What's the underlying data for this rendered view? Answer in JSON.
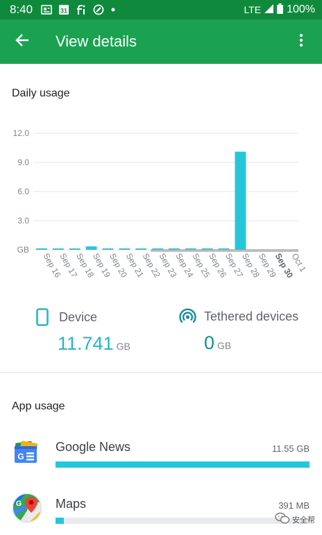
{
  "status_bar": {
    "time": "8:40",
    "network": "LTE",
    "battery": "100%",
    "icons": [
      "news-notification-icon",
      "calendar-icon",
      "fi-icon",
      "speedometer-icon",
      "dot-icon"
    ],
    "calendar_day": "31"
  },
  "app_bar": {
    "title": "View details",
    "back_icon": "arrow-back-icon",
    "more_icon": "more-vert-icon"
  },
  "daily_usage": {
    "title": "Daily usage",
    "chart_data": {
      "type": "bar",
      "categories": [
        "Sep 16",
        "Sep 17",
        "Sep 18",
        "Sep 19",
        "Sep 20",
        "Sep 21",
        "Sep 22",
        "Sep 23",
        "Sep 24",
        "Sep 25",
        "Sep 26",
        "Sep 27",
        "Sep 28",
        "Sep 29",
        "Sep 30",
        "Oct 1"
      ],
      "values": [
        0.15,
        0.02,
        0.05,
        0.35,
        0.03,
        0.05,
        0.05,
        0.1,
        0.05,
        0.1,
        0.1,
        0.1,
        10.1,
        0.0,
        0.0,
        0.0
      ],
      "bold_category": "Sep 30",
      "y_ticks": [
        "12.0",
        "9.0",
        "6.0",
        "3.0",
        "GB"
      ],
      "ylim": [
        0,
        12
      ],
      "grid": true,
      "series_color": "#26c6da",
      "future_color": "#bdbdbd"
    }
  },
  "totals": {
    "device": {
      "label": "Device",
      "value": "11.741",
      "unit": "GB",
      "icon": "phone-icon"
    },
    "tethered": {
      "label": "Tethered devices",
      "value": "0",
      "unit": "GB",
      "icon": "hotspot-icon"
    }
  },
  "app_usage": {
    "title": "App usage",
    "apps": [
      {
        "name": "Google News",
        "size": "11.55 GB",
        "fraction": 1.0,
        "icon": "google-news-icon"
      },
      {
        "name": "Maps",
        "size": "391 MB",
        "fraction": 0.034,
        "icon": "google-maps-icon"
      }
    ]
  },
  "watermark": {
    "text": "安全帮",
    "icon": "wechat-icon"
  },
  "colors": {
    "status_bar": "#0f8a3c",
    "app_bar": "#1aa250",
    "accent": "#26c6da",
    "value_text": "#26b5c9"
  }
}
